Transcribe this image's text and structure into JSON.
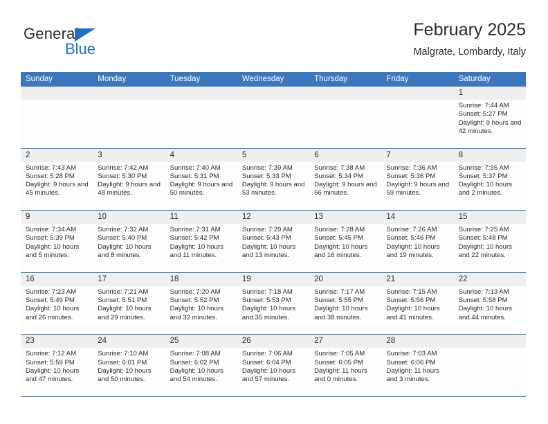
{
  "brand": {
    "name_part1": "General",
    "name_part2": "Blue",
    "triangle_color": "#1f6fc4"
  },
  "header": {
    "title": "February 2025",
    "subtitle": "Malgrate, Lombardy, Italy",
    "accent_color": "#3b77bf"
  },
  "weekdays": [
    "Sunday",
    "Monday",
    "Tuesday",
    "Wednesday",
    "Thursday",
    "Friday",
    "Saturday"
  ],
  "labels": {
    "sunrise": "Sunrise:",
    "sunset": "Sunset:",
    "daylight": "Daylight:"
  },
  "weeks": [
    [
      {
        "day": ""
      },
      {
        "day": ""
      },
      {
        "day": ""
      },
      {
        "day": ""
      },
      {
        "day": ""
      },
      {
        "day": ""
      },
      {
        "day": "1",
        "sunrise": "Sunrise: 7:44 AM",
        "sunset": "Sunset: 5:27 PM",
        "daylight": "Daylight: 9 hours and 42 minutes."
      }
    ],
    [
      {
        "day": "2",
        "sunrise": "Sunrise: 7:43 AM",
        "sunset": "Sunset: 5:28 PM",
        "daylight": "Daylight: 9 hours and 45 minutes."
      },
      {
        "day": "3",
        "sunrise": "Sunrise: 7:42 AM",
        "sunset": "Sunset: 5:30 PM",
        "daylight": "Daylight: 9 hours and 48 minutes."
      },
      {
        "day": "4",
        "sunrise": "Sunrise: 7:40 AM",
        "sunset": "Sunset: 5:31 PM",
        "daylight": "Daylight: 9 hours and 50 minutes."
      },
      {
        "day": "5",
        "sunrise": "Sunrise: 7:39 AM",
        "sunset": "Sunset: 5:33 PM",
        "daylight": "Daylight: 9 hours and 53 minutes."
      },
      {
        "day": "6",
        "sunrise": "Sunrise: 7:38 AM",
        "sunset": "Sunset: 5:34 PM",
        "daylight": "Daylight: 9 hours and 56 minutes."
      },
      {
        "day": "7",
        "sunrise": "Sunrise: 7:36 AM",
        "sunset": "Sunset: 5:36 PM",
        "daylight": "Daylight: 9 hours and 59 minutes."
      },
      {
        "day": "8",
        "sunrise": "Sunrise: 7:35 AM",
        "sunset": "Sunset: 5:37 PM",
        "daylight": "Daylight: 10 hours and 2 minutes."
      }
    ],
    [
      {
        "day": "9",
        "sunrise": "Sunrise: 7:34 AM",
        "sunset": "Sunset: 5:39 PM",
        "daylight": "Daylight: 10 hours and 5 minutes."
      },
      {
        "day": "10",
        "sunrise": "Sunrise: 7:32 AM",
        "sunset": "Sunset: 5:40 PM",
        "daylight": "Daylight: 10 hours and 8 minutes."
      },
      {
        "day": "11",
        "sunrise": "Sunrise: 7:31 AM",
        "sunset": "Sunset: 5:42 PM",
        "daylight": "Daylight: 10 hours and 11 minutes."
      },
      {
        "day": "12",
        "sunrise": "Sunrise: 7:29 AM",
        "sunset": "Sunset: 5:43 PM",
        "daylight": "Daylight: 10 hours and 13 minutes."
      },
      {
        "day": "13",
        "sunrise": "Sunrise: 7:28 AM",
        "sunset": "Sunset: 5:45 PM",
        "daylight": "Daylight: 10 hours and 16 minutes."
      },
      {
        "day": "14",
        "sunrise": "Sunrise: 7:26 AM",
        "sunset": "Sunset: 5:46 PM",
        "daylight": "Daylight: 10 hours and 19 minutes."
      },
      {
        "day": "15",
        "sunrise": "Sunrise: 7:25 AM",
        "sunset": "Sunset: 5:48 PM",
        "daylight": "Daylight: 10 hours and 22 minutes."
      }
    ],
    [
      {
        "day": "16",
        "sunrise": "Sunrise: 7:23 AM",
        "sunset": "Sunset: 5:49 PM",
        "daylight": "Daylight: 10 hours and 26 minutes."
      },
      {
        "day": "17",
        "sunrise": "Sunrise: 7:21 AM",
        "sunset": "Sunset: 5:51 PM",
        "daylight": "Daylight: 10 hours and 29 minutes."
      },
      {
        "day": "18",
        "sunrise": "Sunrise: 7:20 AM",
        "sunset": "Sunset: 5:52 PM",
        "daylight": "Daylight: 10 hours and 32 minutes."
      },
      {
        "day": "19",
        "sunrise": "Sunrise: 7:18 AM",
        "sunset": "Sunset: 5:53 PM",
        "daylight": "Daylight: 10 hours and 35 minutes."
      },
      {
        "day": "20",
        "sunrise": "Sunrise: 7:17 AM",
        "sunset": "Sunset: 5:55 PM",
        "daylight": "Daylight: 10 hours and 38 minutes."
      },
      {
        "day": "21",
        "sunrise": "Sunrise: 7:15 AM",
        "sunset": "Sunset: 5:56 PM",
        "daylight": "Daylight: 10 hours and 41 minutes."
      },
      {
        "day": "22",
        "sunrise": "Sunrise: 7:13 AM",
        "sunset": "Sunset: 5:58 PM",
        "daylight": "Daylight: 10 hours and 44 minutes."
      }
    ],
    [
      {
        "day": "23",
        "sunrise": "Sunrise: 7:12 AM",
        "sunset": "Sunset: 5:59 PM",
        "daylight": "Daylight: 10 hours and 47 minutes."
      },
      {
        "day": "24",
        "sunrise": "Sunrise: 7:10 AM",
        "sunset": "Sunset: 6:01 PM",
        "daylight": "Daylight: 10 hours and 50 minutes."
      },
      {
        "day": "25",
        "sunrise": "Sunrise: 7:08 AM",
        "sunset": "Sunset: 6:02 PM",
        "daylight": "Daylight: 10 hours and 54 minutes."
      },
      {
        "day": "26",
        "sunrise": "Sunrise: 7:06 AM",
        "sunset": "Sunset: 6:04 PM",
        "daylight": "Daylight: 10 hours and 57 minutes."
      },
      {
        "day": "27",
        "sunrise": "Sunrise: 7:05 AM",
        "sunset": "Sunset: 6:05 PM",
        "daylight": "Daylight: 11 hours and 0 minutes."
      },
      {
        "day": "28",
        "sunrise": "Sunrise: 7:03 AM",
        "sunset": "Sunset: 6:06 PM",
        "daylight": "Daylight: 11 hours and 3 minutes."
      },
      {
        "day": ""
      }
    ]
  ]
}
